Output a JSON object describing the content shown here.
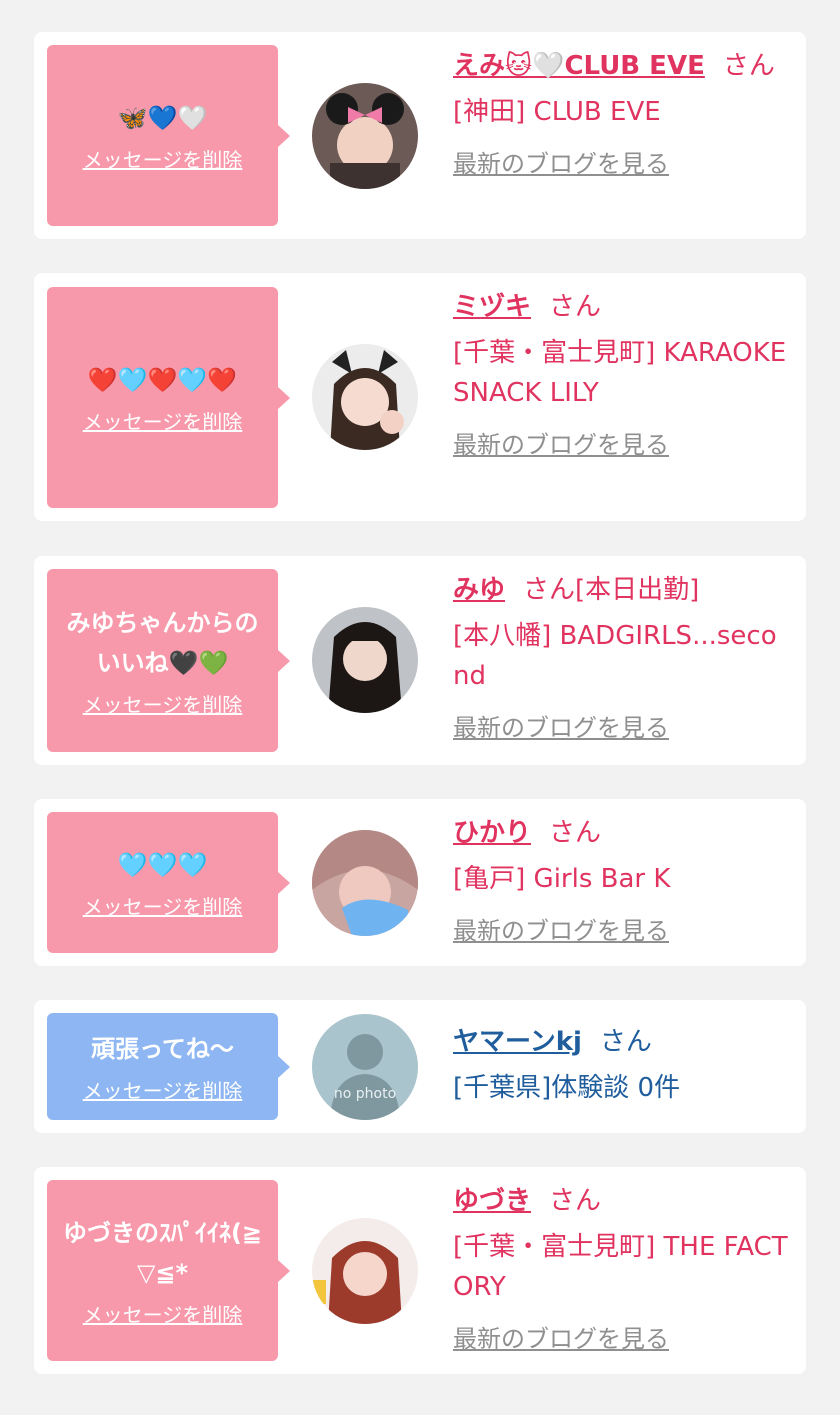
{
  "entries": [
    {
      "message": "🦋💙🤍",
      "delete_label": "メッセージを削除",
      "name": "えみ🐱🤍CLUB EVE",
      "suffix": "さん",
      "shop": "[神田] CLUB EVE",
      "blog_label": "最新のブログを見る"
    },
    {
      "message": "❤️🩵❤️🩵❤️",
      "delete_label": "メッセージを削除",
      "name": "ミヅキ",
      "suffix": "さん",
      "shop": "[千葉・富士見町] KARAOKE SNACK LILY",
      "blog_label": "最新のブログを見る"
    },
    {
      "message": "みゆちゃんからのいいね🖤💚",
      "delete_label": "メッセージを削除",
      "name": "みゆ",
      "suffix": "さん[本日出勤]",
      "shop": "[本八幡] BADGIRLS...second",
      "blog_label": "最新のブログを見る"
    },
    {
      "message": "🩵🩵🩵",
      "delete_label": "メッセージを削除",
      "name": "ひかり",
      "suffix": "さん",
      "shop": "[亀戸] Girls Bar K",
      "blog_label": "最新のブログを見る"
    },
    {
      "message": "頑張ってね〜",
      "delete_label": "メッセージを削除",
      "name": "ヤマーンkj",
      "suffix": "さん",
      "shop": "[千葉県]体験談 0件",
      "avatar_text": "no photo"
    },
    {
      "message": "ゆづきのｽﾊﾟｲｲﾈ(≧▽≦*",
      "delete_label": "メッセージを削除",
      "name": "ゆづき",
      "suffix": "さん",
      "shop": "[千葉・富士見町] THE FACTORY",
      "blog_label": "最新のブログを見る"
    }
  ],
  "colors": {
    "pink_bubble": "#f799aa",
    "blue_bubble": "#8db6f2",
    "pink_text": "#e0335f",
    "blue_text": "#1f5d9c"
  }
}
